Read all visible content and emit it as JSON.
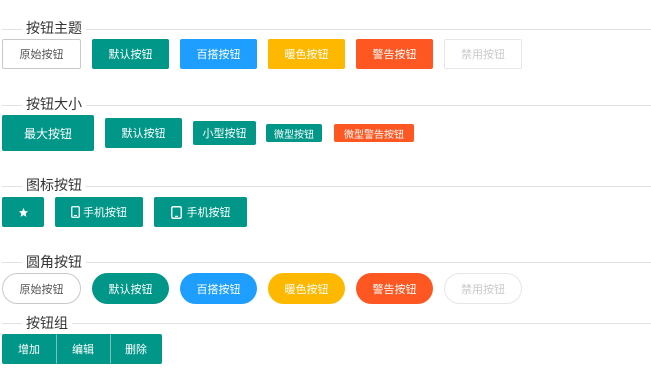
{
  "colors": {
    "primary": "#009688",
    "normal": "#1E9FFF",
    "warm": "#FFB800",
    "danger": "#FF5722",
    "divider": "#e2e2e2"
  },
  "sections": {
    "theme": {
      "title": "按钮主题",
      "buttons": {
        "original": "原始按钮",
        "default": "默认按钮",
        "normal": "百搭按钮",
        "warm": "暖色按钮",
        "danger": "警告按钮",
        "disabled": "禁用按钮"
      }
    },
    "size": {
      "title": "按钮大小",
      "buttons": {
        "large": "最大按钮",
        "default": "默认按钮",
        "small": "小型按钮",
        "mini": "微型按钮",
        "mini_danger": "微型警告按钮"
      }
    },
    "icon": {
      "title": "图标按钮",
      "icons": [
        "star-icon",
        "mobile-icon",
        "tablet-icon"
      ],
      "buttons": {
        "phone_1": "手机按钮",
        "phone_2": "手机按钮"
      }
    },
    "radius": {
      "title": "圆角按钮",
      "buttons": {
        "original": "原始按钮",
        "default": "默认按钮",
        "normal": "百搭按钮",
        "warm": "暖色按钮",
        "danger": "警告按钮",
        "disabled": "禁用按钮"
      }
    },
    "group": {
      "title": "按钮组",
      "buttons": {
        "add": "增加",
        "edit": "编辑",
        "delete": "删除"
      }
    }
  }
}
